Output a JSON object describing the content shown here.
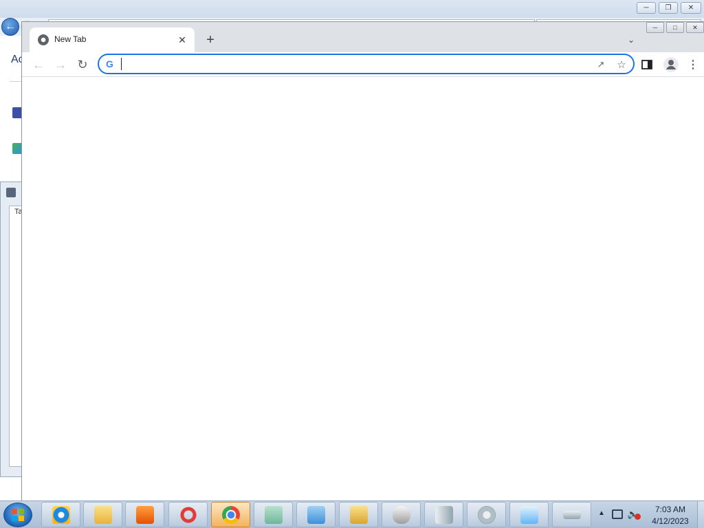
{
  "browser": {
    "tab": {
      "title": "New Tab"
    },
    "omnibox": {
      "value": "",
      "placeholder": ""
    },
    "icons": [
      "chrome-favicon",
      "close-icon",
      "plus-icon",
      "chevron-down-icon",
      "back-arrow-icon",
      "forward-arrow-icon",
      "reload-icon",
      "google-g-icon",
      "share-icon",
      "star-icon",
      "side-panel-icon",
      "profile-icon",
      "kebab-menu-icon"
    ],
    "accent_color": "#1a73e8"
  },
  "background_window": {
    "address_text": "Ac",
    "subwindow_tab_text": "Ta"
  },
  "taskbar": {
    "apps": [
      {
        "name": "internet-explorer",
        "active": false
      },
      {
        "name": "file-explorer",
        "active": false
      },
      {
        "name": "media-player",
        "active": false
      },
      {
        "name": "ccleaner",
        "active": false
      },
      {
        "name": "chrome",
        "active": true
      },
      {
        "name": "document-app",
        "active": false
      },
      {
        "name": "control-panel",
        "active": false
      },
      {
        "name": "folder-tasks",
        "active": false
      },
      {
        "name": "mouse-settings",
        "active": false
      },
      {
        "name": "server-app",
        "active": false
      },
      {
        "name": "sound-settings",
        "active": false
      },
      {
        "name": "date-time-settings",
        "active": false
      },
      {
        "name": "keyboard-settings",
        "active": false
      }
    ],
    "clock": {
      "time": "7:03 AM",
      "date": "4/12/2023"
    }
  }
}
